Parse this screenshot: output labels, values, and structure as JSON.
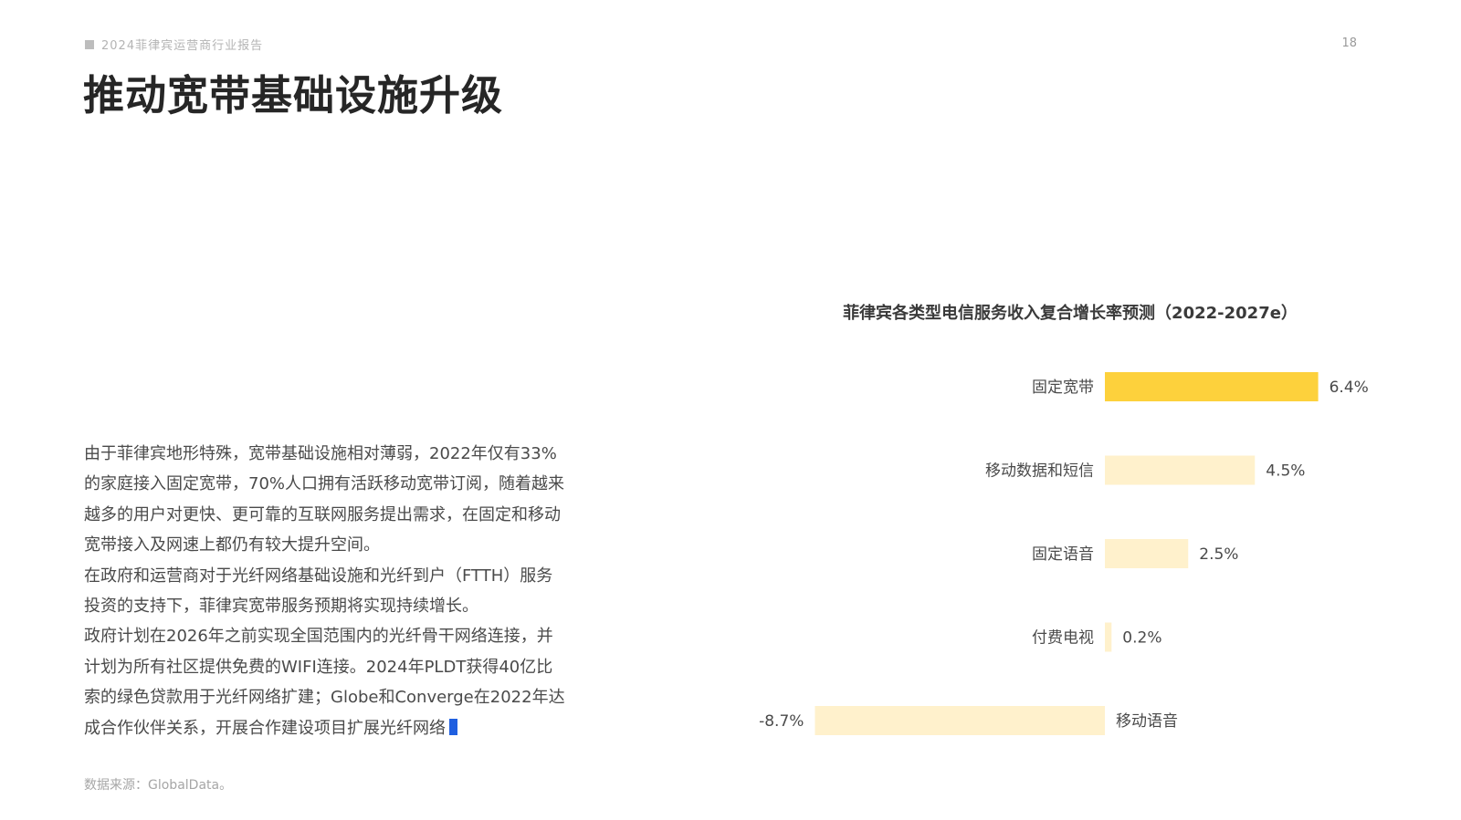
{
  "header": {
    "report_label": "2024菲律宾运营商行业报告",
    "page_number": "18",
    "title": "推动宽带基础设施升级"
  },
  "body": {
    "paragraphs": [
      "由于菲律宾地形特殊，宽带基础设施相对薄弱，2022年仅有33%的家庭接入固定宽带，70%人口拥有活跃移动宽带订阅，随着越来越多的用户对更快、更可靠的互联网服务提出需求，在固定和移动宽带接入及网速上都仍有较大提升空间。",
      "在政府和运营商对于光纤网络基础设施和光纤到户（FTTH）服务投资的支持下，菲律宾宽带服务预期将实现持续增长。",
      "政府计划在2026年之前实现全国范围内的光纤骨干网络连接，并计划为所有社区提供免费的WIFI连接。2024年PLDT获得40亿比索的绿色贷款用于光纤网络扩建；Globe和Converge在2022年达成合作伙伴关系，开展合作建设项目扩展光纤网络"
    ]
  },
  "source": "数据来源：GlobalData。",
  "chart_data": {
    "type": "bar",
    "orientation": "horizontal",
    "title": "菲律宾各类型电信服务收入复合增长率预测（2022-2027e）",
    "categories": [
      "固定宽带",
      "移动数据和短信",
      "固定语音",
      "付费电视",
      "移动语音"
    ],
    "values": [
      6.4,
      4.5,
      2.5,
      0.2,
      -8.7
    ],
    "value_labels": [
      "6.4%",
      "4.5%",
      "2.5%",
      "0.2%",
      "-8.7%"
    ],
    "unit": "%",
    "highlight_color": "#fdd13c",
    "base_color": "#fff1cc",
    "highlight_index": 0,
    "grid": false,
    "legend": "none"
  }
}
